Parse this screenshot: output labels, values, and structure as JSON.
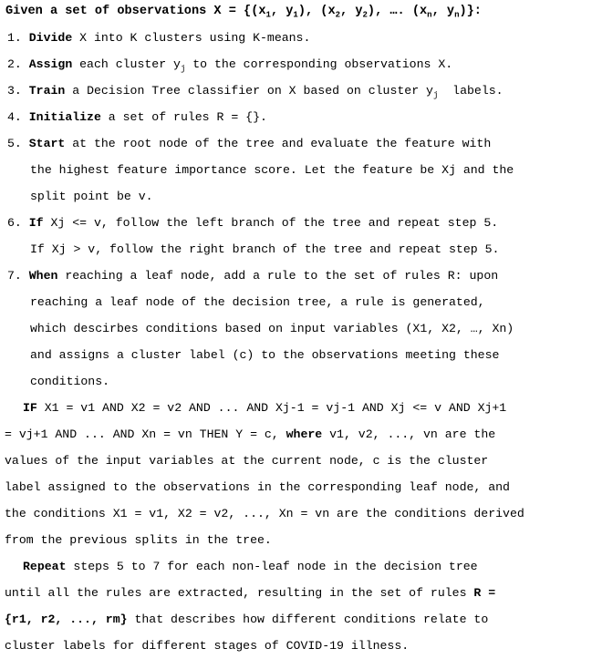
{
  "document": {
    "type": "algorithm-pseudocode",
    "title_line": {
      "prefix": "Given a set of observations X = {(x",
      "sub1": "1",
      "mid1": ", y",
      "sub2": "1",
      "mid2": "), (x",
      "sub3": "2",
      "mid3": ", y",
      "sub4": "2",
      "mid4": "), …. (x",
      "sub5": "n",
      "mid5": ", y",
      "sub6": "n",
      "suffix": ")}:"
    },
    "steps": [
      {
        "number": "1.",
        "keyword": "Divide",
        "lines": [
          " X into K clusters using K-means."
        ]
      },
      {
        "number": "2.",
        "keyword": "Assign",
        "lines": [
          " each cluster y",
          " to the corresponding observations X."
        ],
        "subscript": "j"
      },
      {
        "number": "3.",
        "keyword": "Train",
        "lines": [
          " a Decision Tree classifier on X based on cluster y",
          "  labels."
        ],
        "subscript": "j"
      },
      {
        "number": "4.",
        "keyword": "Initialize",
        "lines": [
          " a set of rules R = {}."
        ]
      },
      {
        "number": "5.",
        "keyword": "Start",
        "lines": [
          " at the root node of the tree and evaluate the feature with",
          "the highest feature importance score. Let the feature be Xj and the",
          "split point be v."
        ]
      },
      {
        "number": "6.",
        "keyword": "If",
        "lines": [
          " Xj <= v, follow the left branch of the tree and repeat step 5.",
          "If Xj > v, follow the right branch of the tree and repeat step 5."
        ]
      },
      {
        "number": "7.",
        "keyword": "When",
        "lines": [
          " reaching a leaf node, add a rule to the set of rules R: upon",
          "reaching a leaf node of the decision tree, a rule is generated,",
          "which descirbes conditions based on input variables (X1, X2, …, Xn)",
          "and assigns a cluster label (c) to the observations meeting these",
          "conditions."
        ]
      }
    ],
    "rule_paragraph": {
      "keyword": "IF",
      "line1_rest": " X1 = v1 AND X2 = v2 AND ... AND Xj-1 = vj-1 AND Xj <= v AND Xj+1",
      "line2_pre": "= vj+1 AND ... AND Xn = vn THEN Y = c, ",
      "line2_bold": "where",
      "line2_post": " v1, v2, ..., vn are the",
      "line3": "values of the input variables at the current node, c is the cluster",
      "line4": "label assigned to the observations in the corresponding leaf node, and",
      "line5": "the conditions X1 = v1, X2 = v2, ..., Xn = vn are the conditions derived",
      "line6": "from the previous splits in the tree."
    },
    "repeat_paragraph": {
      "keyword": "Repeat",
      "line1_rest": " steps 5 to 7 for each non-leaf node in the decision tree",
      "line2_pre": "until all the rules are extracted, resulting in the set of rules ",
      "line2_bold": "R =",
      "line3_bold": "{r1, r2, ..., rm}",
      "line3_post": " that describes how different conditions relate to",
      "line4": "cluster labels for different stages of COVID-19 illness."
    }
  }
}
